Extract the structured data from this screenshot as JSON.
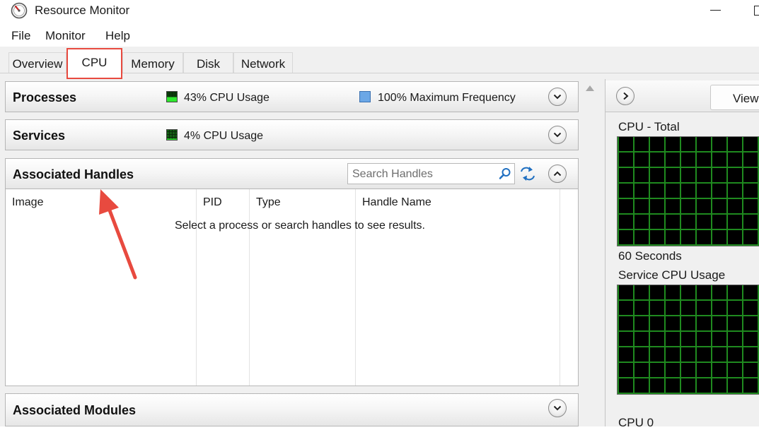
{
  "window": {
    "title": "Resource Monitor"
  },
  "menu": [
    "File",
    "Monitor",
    "Help"
  ],
  "tabs": [
    {
      "label": "Overview",
      "active": false
    },
    {
      "label": "CPU",
      "active": true
    },
    {
      "label": "Memory",
      "active": false
    },
    {
      "label": "Disk",
      "active": false
    },
    {
      "label": "Network",
      "active": false
    }
  ],
  "sections": {
    "processes": {
      "title": "Processes",
      "cpu_usage": "43% CPU Usage",
      "max_frequency": "100% Maximum Frequency",
      "expand_icon": "chevron-down-icon"
    },
    "services": {
      "title": "Services",
      "cpu_usage": "4% CPU Usage",
      "expand_icon": "chevron-down-icon"
    },
    "handles": {
      "title": "Associated Handles",
      "search_placeholder": "Search Handles",
      "columns": [
        "Image",
        "PID",
        "Type",
        "Handle Name"
      ],
      "empty_message": "Select a process or search handles to see results.",
      "collapse_icon": "chevron-up-icon"
    },
    "modules": {
      "title": "Associated Modules",
      "expand_icon": "chevron-down-icon"
    }
  },
  "graphs": {
    "views_button": "Views",
    "cpu_total": "CPU - Total",
    "time_label": "60 Seconds",
    "service_cpu": "Service CPU Usage",
    "cpu0": "CPU 0"
  },
  "colors": {
    "highlight": "#e84a3f",
    "meter_green": "#2ee82e",
    "meter_blue": "#6ba7e6",
    "graph_grid": "#1f8a1f"
  }
}
